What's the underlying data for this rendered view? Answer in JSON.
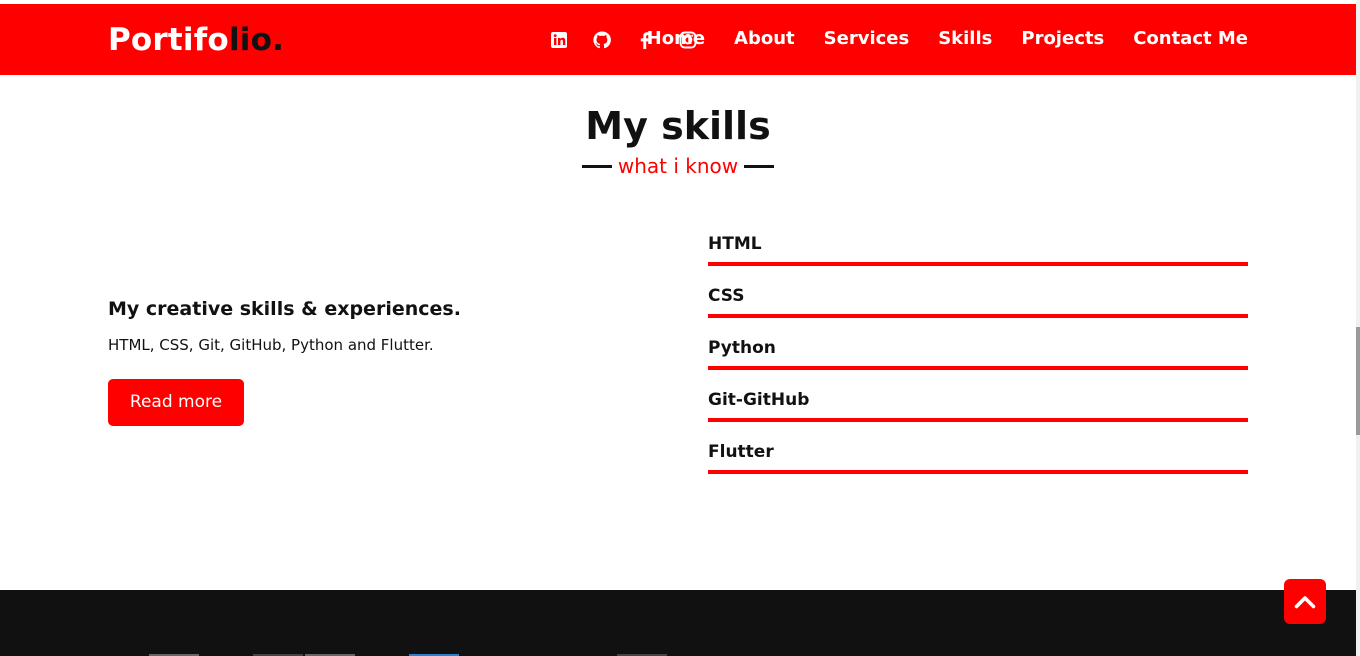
{
  "brand": {
    "logo_main": "Portifo",
    "logo_accent": "lio."
  },
  "nav": {
    "social_icons": [
      "linkedin-icon",
      "github-icon",
      "facebook-icon",
      "instagram-icon"
    ],
    "links": [
      "Home",
      "About",
      "Services",
      "Skills",
      "Projects",
      "Contact Me"
    ]
  },
  "skills_section": {
    "title": "My skills",
    "subtitle": "what i know",
    "heading": "My creative skills & experiences.",
    "description": "HTML, CSS, Git, GitHub, Python and Flutter.",
    "button_label": "Read more",
    "items": [
      {
        "name": "HTML",
        "level": 1.0
      },
      {
        "name": "CSS",
        "level": 1.0
      },
      {
        "name": "Python",
        "level": 1.0
      },
      {
        "name": "Git-GitHub",
        "level": 1.0
      },
      {
        "name": "Flutter",
        "level": 1.0
      }
    ]
  },
  "scroll_top": {
    "icon": "chevron-up-icon"
  },
  "colors": {
    "accent": "#ff0000",
    "footer": "#111111",
    "text": "#111111"
  }
}
